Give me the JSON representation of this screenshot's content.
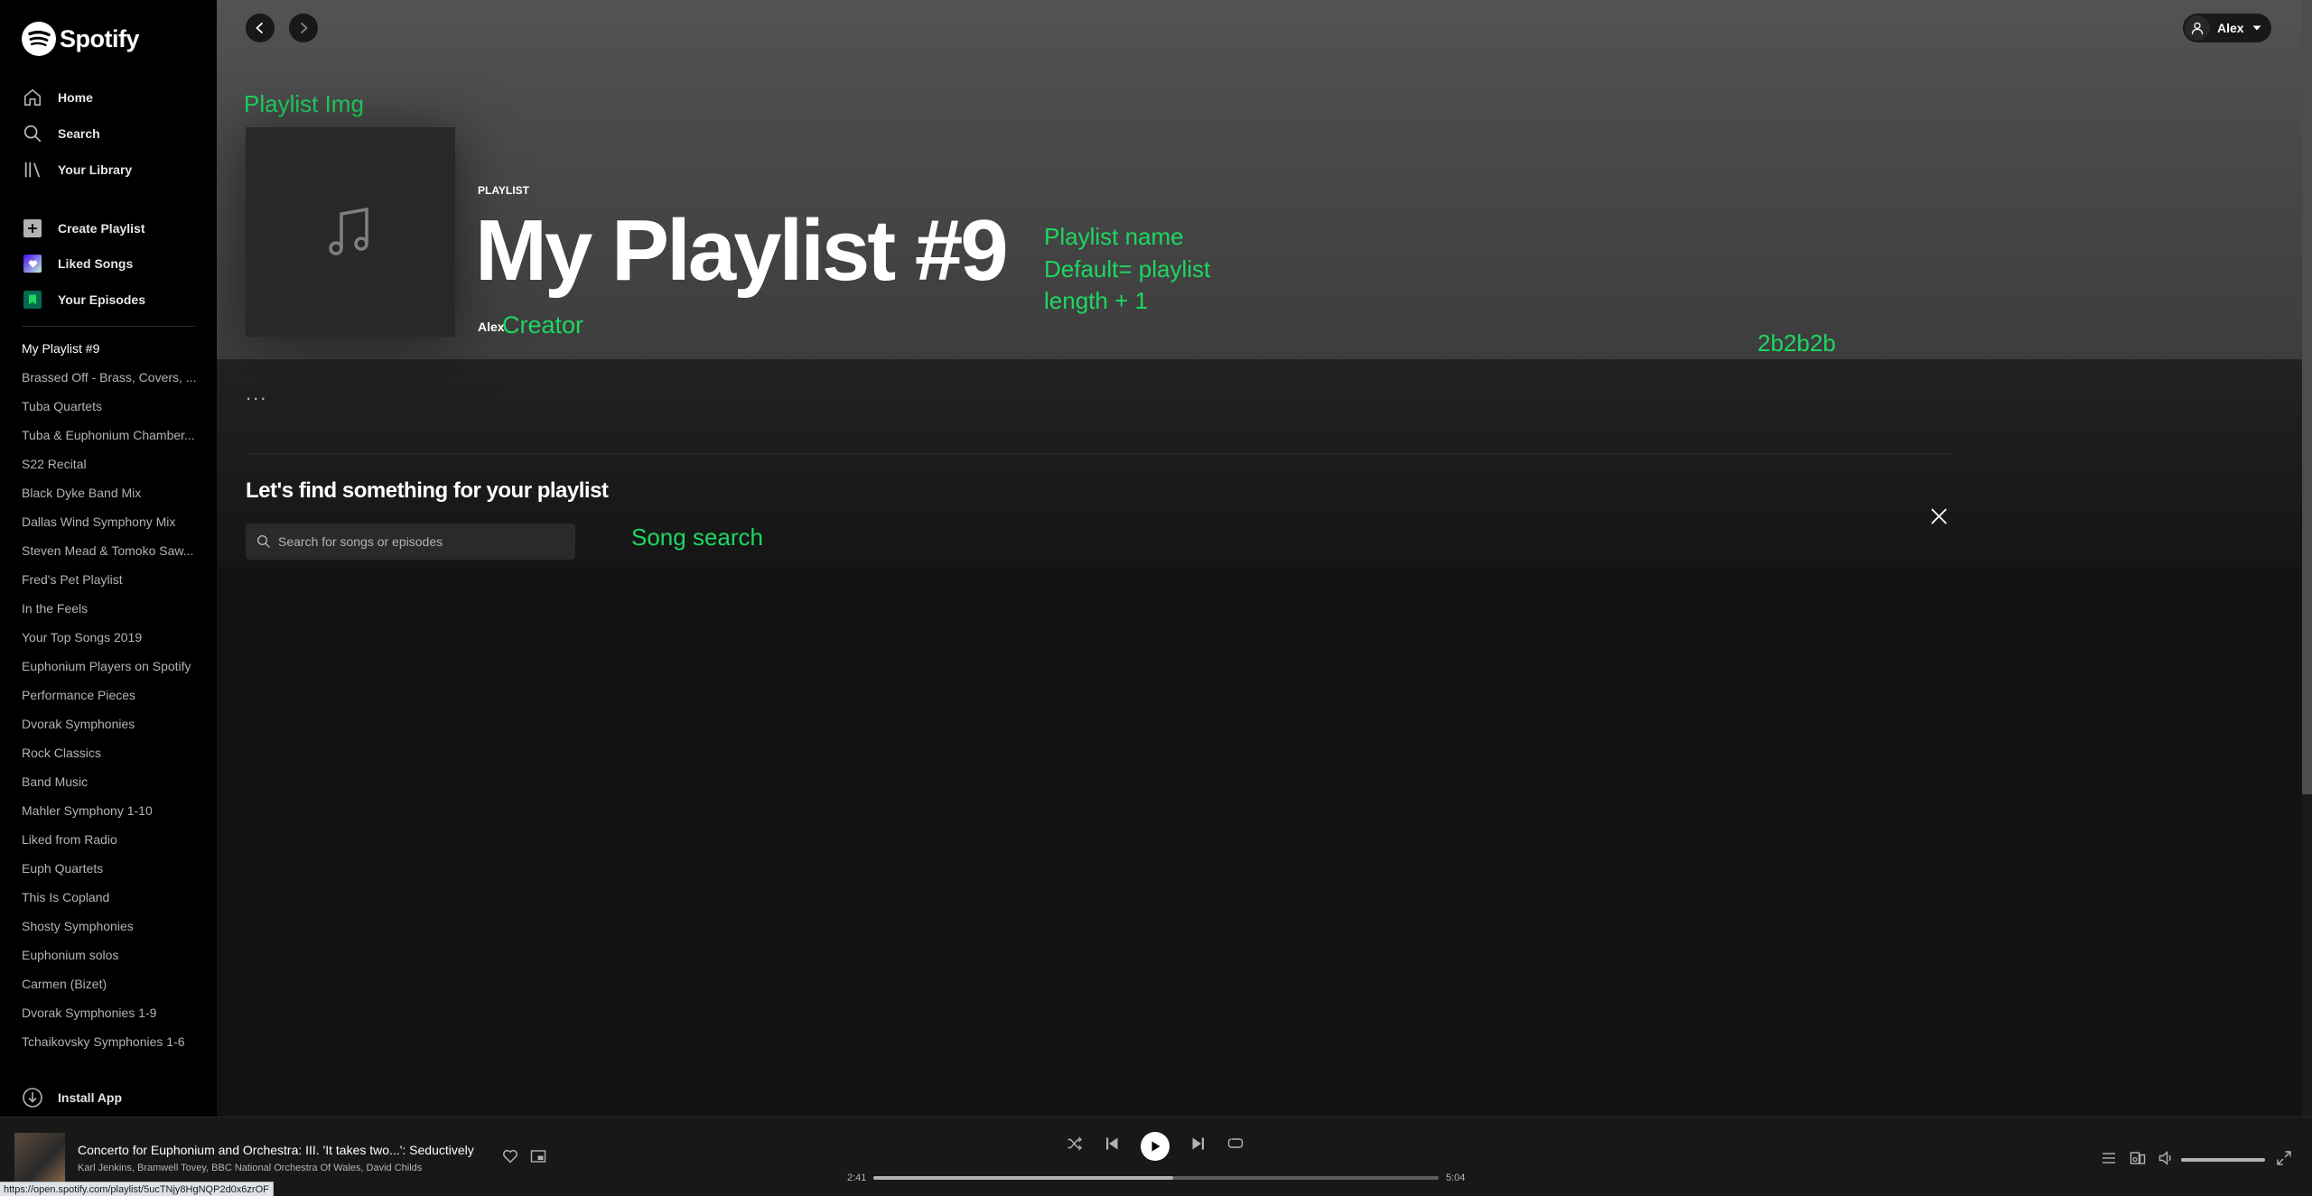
{
  "app": {
    "name": "Spotify"
  },
  "sidebar": {
    "nav": [
      {
        "label": "Home",
        "icon": "home-icon"
      },
      {
        "label": "Search",
        "icon": "search-icon"
      },
      {
        "label": "Your Library",
        "icon": "library-icon"
      }
    ],
    "actions": [
      {
        "label": "Create Playlist",
        "icon": "plus-icon"
      },
      {
        "label": "Liked Songs",
        "icon": "heart-icon"
      },
      {
        "label": "Your Episodes",
        "icon": "bookmark-icon"
      }
    ],
    "playlists": [
      "My Playlist #9",
      "Brassed Off - Brass, Covers, ...",
      "Tuba Quartets",
      "Tuba & Euphonium Chamber...",
      "S22 Recital",
      "Black Dyke Band Mix",
      "Dallas Wind Symphony Mix",
      "Steven Mead & Tomoko Saw...",
      "Fred's Pet Playlist",
      "In the Feels",
      "Your Top Songs 2019",
      "Euphonium Players on Spotify",
      "Performance Pieces",
      "Dvorak Symphonies",
      "Rock Classics",
      "Band Music",
      "Mahler Symphony 1-10",
      "Liked from Radio",
      "Euph Quartets",
      "This Is Copland",
      "Shosty Symphonies",
      "Euphonium solos",
      "Carmen (Bizet)",
      "Dvorak Symphonies 1-9",
      "Tchaikovsky Symphonies 1-6"
    ],
    "install_label": "Install App"
  },
  "header": {
    "user_name": "Alex"
  },
  "playlist": {
    "type": "PLAYLIST",
    "title": "My Playlist #9",
    "creator": "Alex"
  },
  "annotations": {
    "playlist_img": "Playlist Img",
    "playlist_name_1": "Playlist name",
    "playlist_name_2": "Default= playlist",
    "playlist_name_3": "length + 1",
    "creator": "Creator",
    "color": "2b2b2b",
    "song_search": "Song search"
  },
  "find": {
    "more": "...",
    "title": "Let's find something for your playlist",
    "search_placeholder": "Search for songs or episodes"
  },
  "player": {
    "track_title": "Concerto for Euphonium and Orchestra: III. 'It takes two...': Seductively",
    "artists": "Karl Jenkins, Bramwell Tovey, BBC National Orchestra Of Wales, David Childs",
    "elapsed": "2:41",
    "duration": "5:04",
    "progress_fraction": 0.53,
    "volume_fraction": 1.0
  },
  "status_url": "https://open.spotify.com/playlist/5ucTNjy8HgNQP2d0x6zrOF",
  "colors": {
    "accent": "#1ed760",
    "sidebar": "#000000",
    "main": "#121212",
    "player": "#181818"
  }
}
